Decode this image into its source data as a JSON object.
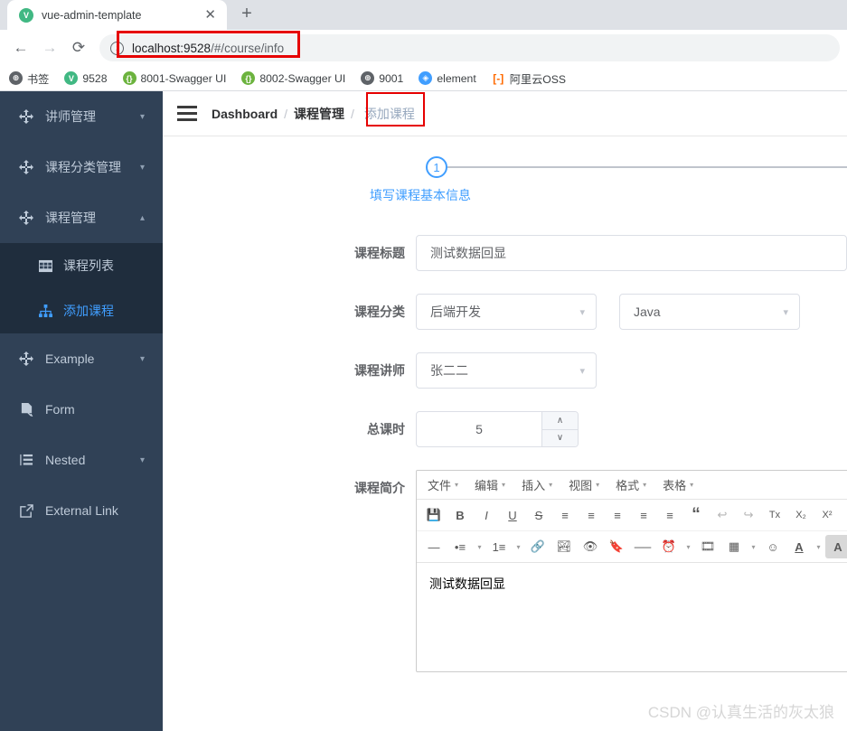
{
  "browser": {
    "tab": {
      "title": "vue-admin-template",
      "favicon": "vue-icon",
      "close_label": "✕"
    },
    "newtab_label": "+",
    "nav": {
      "back": "←",
      "forward": "→",
      "reload": "⟳"
    },
    "omnibox": {
      "url_host": "localhost:9528",
      "url_path": "/#/course/info",
      "info_icon": "i"
    },
    "bookmarks": [
      {
        "label": "书签",
        "icon": "globe-icon",
        "style": "ico-globe",
        "glyph": "⊕"
      },
      {
        "label": "9528",
        "icon": "vue-icon",
        "style": "ico-vue",
        "glyph": "V"
      },
      {
        "label": "8001-Swagger UI",
        "icon": "swagger-icon",
        "style": "ico-swagger",
        "glyph": "{}"
      },
      {
        "label": "8002-Swagger UI",
        "icon": "swagger-icon",
        "style": "ico-swagger",
        "glyph": "{}"
      },
      {
        "label": "9001",
        "icon": "globe-icon",
        "style": "ico-globe",
        "glyph": "⊕"
      },
      {
        "label": "element",
        "icon": "element-icon",
        "style": "ico-element",
        "glyph": "◈"
      },
      {
        "label": "阿里云OSS",
        "icon": "aliyun-icon",
        "style": "ico-ali",
        "glyph": "[-]"
      }
    ]
  },
  "sidebar": {
    "bg_color": "#304156",
    "active_color": "#409EFF",
    "items": [
      {
        "label": "讲师管理",
        "icon": "component-icon",
        "arrow": "∨",
        "expanded": false
      },
      {
        "label": "课程分类管理",
        "icon": "component-icon",
        "arrow": "∨",
        "expanded": false
      },
      {
        "label": "课程管理",
        "icon": "component-icon",
        "arrow": "∧",
        "expanded": true
      }
    ],
    "submenu": [
      {
        "label": "课程列表",
        "icon": "table-icon",
        "active": false
      },
      {
        "label": "添加课程",
        "icon": "tree-icon",
        "active": true
      }
    ],
    "items_after": [
      {
        "label": "Example",
        "icon": "component-icon",
        "arrow": "∨"
      },
      {
        "label": "Form",
        "icon": "form-icon",
        "arrow": ""
      },
      {
        "label": "Nested",
        "icon": "nested-icon",
        "arrow": "∨"
      },
      {
        "label": "External Link",
        "icon": "link-icon",
        "arrow": ""
      }
    ]
  },
  "topbar": {
    "hamburger": "menu-icon",
    "breadcrumb": [
      {
        "label": "Dashboard",
        "current": false
      },
      {
        "label": "课程管理",
        "current": false
      },
      {
        "label": "添加课程",
        "current": true
      }
    ],
    "separator": "/"
  },
  "steps": {
    "number": "1",
    "title": "填写课程基本信息"
  },
  "form": {
    "title": {
      "label": "课程标题",
      "value": "测试数据回显"
    },
    "category": {
      "label": "课程分类",
      "parent_value": "后端开发",
      "child_value": "Java"
    },
    "teacher": {
      "label": "课程讲师",
      "value": "张二二"
    },
    "lessons": {
      "label": "总课时",
      "value": "5",
      "up": "∧",
      "down": "∨"
    },
    "description": {
      "label": "课程简介",
      "content": "测试数据回显"
    }
  },
  "editor": {
    "menubar": [
      "文件",
      "编辑",
      "插入",
      "视图",
      "格式",
      "表格"
    ],
    "caret": "▾",
    "toolbar_row1": [
      {
        "name": "save-icon",
        "glyph": "💾",
        "faded": false
      },
      {
        "name": "bold-icon",
        "glyph": "B",
        "faded": false
      },
      {
        "name": "italic-icon",
        "glyph": "I",
        "faded": false
      },
      {
        "name": "underline-icon",
        "glyph": "U",
        "faded": false
      },
      {
        "name": "strikethrough-icon",
        "glyph": "S",
        "faded": false
      },
      {
        "name": "align-left-icon",
        "glyph": "≡",
        "faded": false
      },
      {
        "name": "align-center-icon",
        "glyph": "≡",
        "faded": false
      },
      {
        "name": "align-right-icon",
        "glyph": "≡",
        "faded": false
      },
      {
        "name": "outdent-icon",
        "glyph": "≡",
        "faded": false
      },
      {
        "name": "indent-icon",
        "glyph": "≡",
        "faded": false
      },
      {
        "name": "blockquote-icon",
        "glyph": "“",
        "faded": false
      },
      {
        "name": "undo-icon",
        "glyph": "↩",
        "faded": true
      },
      {
        "name": "redo-icon",
        "glyph": "↪",
        "faded": true
      },
      {
        "name": "remove-format-icon",
        "glyph": "Tx",
        "faded": false
      },
      {
        "name": "subscript-icon",
        "glyph": "X₂",
        "faded": false
      },
      {
        "name": "superscript-icon",
        "glyph": "X²",
        "faded": false
      },
      {
        "name": "code-icon",
        "glyph": "<>",
        "faded": false
      },
      {
        "name": "source-code-icon",
        "glyph": "{;}",
        "faded": false
      }
    ],
    "toolbar_row2": [
      {
        "name": "horizontal-rule-icon",
        "glyph": "—",
        "caret": false
      },
      {
        "name": "bullet-list-icon",
        "glyph": "•≡",
        "caret": true
      },
      {
        "name": "numbered-list-icon",
        "glyph": "1≡",
        "caret": true
      },
      {
        "name": "link-icon",
        "glyph": "🔗",
        "caret": false
      },
      {
        "name": "image-icon",
        "glyph": "🏞",
        "caret": false
      },
      {
        "name": "preview-icon",
        "glyph": "👁",
        "caret": false
      },
      {
        "name": "anchor-icon",
        "glyph": "🔖",
        "caret": false
      },
      {
        "name": "page-break-icon",
        "glyph": "──",
        "caret": false
      },
      {
        "name": "insert-datetime-icon",
        "glyph": "⏰",
        "caret": true
      },
      {
        "name": "media-icon",
        "glyph": "🎞",
        "caret": false
      },
      {
        "name": "table-icon",
        "glyph": "▦",
        "caret": true
      },
      {
        "name": "emoticons-icon",
        "glyph": "☺",
        "caret": false
      },
      {
        "name": "forecolor-icon",
        "glyph": "A",
        "caret": true
      },
      {
        "name": "backcolor-icon",
        "glyph": "A",
        "caret": true
      },
      {
        "name": "fullscreen-icon",
        "glyph": "⤡",
        "caret": false
      }
    ]
  },
  "watermark": "CSDN @认真生活的灰太狼"
}
